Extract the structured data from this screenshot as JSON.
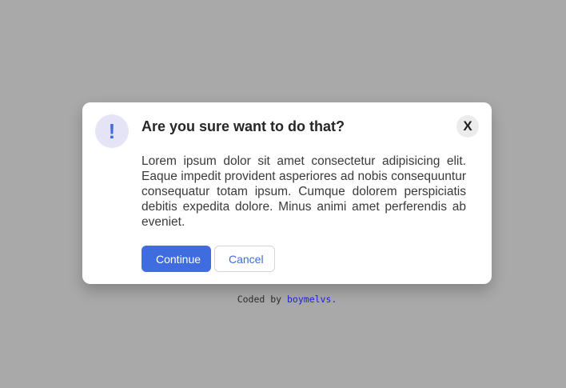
{
  "modal": {
    "badge_symbol": "!",
    "title": "Are you sure want to do that?",
    "close_label": "X",
    "body": "Lorem ipsum dolor sit amet consectetur adipisicing elit. Eaque impedit provident asperiores ad nobis consequuntur consequatur totam ipsum. Cumque dolorem perspiciatis debitis expedita dolore. Minus animi amet perferendis ab eveniet.",
    "continue_label": "Continue",
    "cancel_label": "Cancel"
  },
  "footer": {
    "credit_prefix": "Coded by ",
    "author": "boymelvs."
  },
  "colors": {
    "background": "#a9a9a9",
    "accent": "#3f6ddf",
    "badge_bg": "#e4e4f6",
    "link": "#2020d8"
  }
}
